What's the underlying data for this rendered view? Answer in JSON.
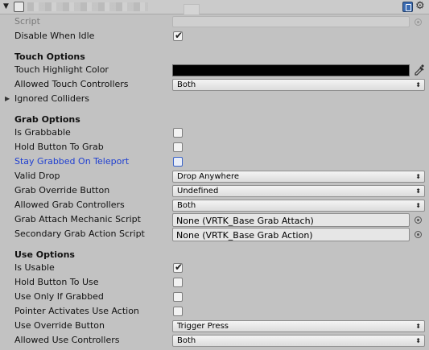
{
  "header": {
    "fold_glyph": "▼",
    "icons": [
      "component-icon",
      "book-icon",
      "gear-icon"
    ]
  },
  "rows": {
    "script": {
      "label": "Script"
    },
    "disable_when_idle": {
      "label": "Disable When Idle",
      "checked": true
    },
    "touch_options": {
      "label": "Touch Options"
    },
    "touch_highlight_color": {
      "label": "Touch Highlight Color",
      "value": "#000000"
    },
    "allowed_touch_controllers": {
      "label": "Allowed Touch Controllers",
      "value": "Both"
    },
    "ignored_colliders": {
      "label": "Ignored Colliders"
    },
    "grab_options": {
      "label": "Grab Options"
    },
    "is_grabbable": {
      "label": "Is Grabbable",
      "checked": false
    },
    "hold_button_to_grab": {
      "label": "Hold Button To Grab",
      "checked": false
    },
    "stay_grabbed_on_teleport": {
      "label": "Stay Grabbed On Teleport",
      "checked": false
    },
    "valid_drop": {
      "label": "Valid Drop",
      "value": "Drop Anywhere"
    },
    "grab_override_button": {
      "label": "Grab Override Button",
      "value": "Undefined"
    },
    "allowed_grab_controllers": {
      "label": "Allowed Grab Controllers",
      "value": "Both"
    },
    "grab_attach_mechanic_script": {
      "label": "Grab Attach Mechanic Script",
      "value": "None (VRTK_Base Grab Attach)"
    },
    "secondary_grab_action_script": {
      "label": "Secondary Grab Action Script",
      "value": "None (VRTK_Base Grab Action)"
    },
    "use_options": {
      "label": "Use Options"
    },
    "is_usable": {
      "label": "Is Usable",
      "checked": true
    },
    "hold_button_to_use": {
      "label": "Hold Button To Use",
      "checked": false
    },
    "use_only_if_grabbed": {
      "label": "Use Only If Grabbed",
      "checked": false
    },
    "pointer_activates_use_action": {
      "label": "Pointer Activates Use Action",
      "checked": false
    },
    "use_override_button": {
      "label": "Use Override Button",
      "value": "Trigger Press"
    },
    "allowed_use_controllers": {
      "label": "Allowed Use Controllers",
      "value": "Both"
    }
  },
  "glyphs": {
    "check": "✔",
    "arrows": "⬍",
    "foldout_closed": "▶"
  },
  "colors": {
    "panel_bg": "#c2c2c2",
    "prefab_override_label": "#1f3fd1"
  }
}
